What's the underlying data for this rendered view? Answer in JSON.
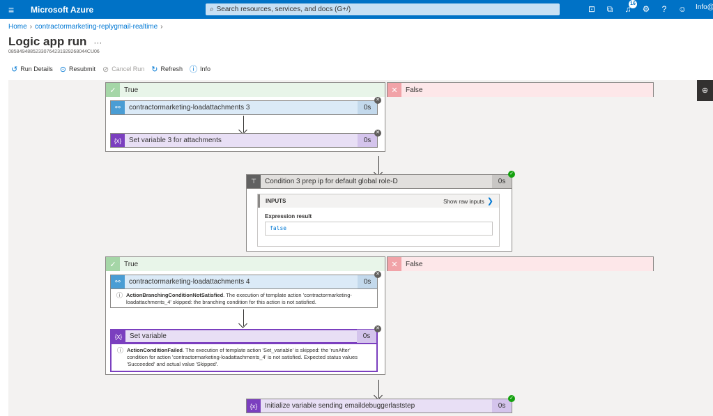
{
  "topbar": {
    "brand": "Microsoft Azure",
    "search_placeholder": "Search resources, services, and docs (G+/)",
    "notifications_count": "16",
    "user": "Info@"
  },
  "breadcrumb": {
    "home": "Home",
    "resource": "contractormarketing-replygmail-realtime"
  },
  "page": {
    "title": "Logic app run",
    "more": "···",
    "run_id": "08584948852330764231929268044CU06"
  },
  "toolbar": {
    "run_details": "Run Details",
    "resubmit": "Resubmit",
    "cancel_run": "Cancel Run",
    "refresh": "Refresh",
    "info": "Info"
  },
  "flow": {
    "scope1": {
      "true_label": "True",
      "false_label": "False",
      "action1": {
        "name": "contractormarketing-loadattachments 3",
        "duration": "0s"
      },
      "action2": {
        "name": "Set variable 3 for attachments",
        "duration": "0s"
      }
    },
    "condition": {
      "name": "Condition 3 prep ip for default global role-D",
      "duration": "0s",
      "inputs_label": "INPUTS",
      "show_raw": "Show raw inputs",
      "expression_label": "Expression result",
      "expression_value": "false"
    },
    "scope2": {
      "true_label": "True",
      "false_label": "False",
      "action1": {
        "name": "contractormarketing-loadattachments 4",
        "duration": "0s",
        "error_title": "ActionBranchingConditionNotSatisfied",
        "error_text": ". The execution of template action 'contractormarketing-loadattachments_4' skipped: the branching condition for this action is not satisfied."
      },
      "action2": {
        "name": "Set variable",
        "duration": "0s",
        "error_title": "ActionConditionFailed",
        "error_text": ". The execution of template action 'Set_variable' is skipped: the 'runAfter' condition for action 'contractormarketing-loadattachments_4' is not satisfied. Expected status values 'Succeeded' and actual value 'Skipped'."
      }
    },
    "final": {
      "name": "Initialize variable sending emaildebuggerlaststep",
      "duration": "0s"
    }
  },
  "colors": {
    "azure_blue": "#0072c6",
    "success": "#13a10e",
    "skipped": "#605e5c",
    "variable_purple": "#7b3fbf"
  }
}
